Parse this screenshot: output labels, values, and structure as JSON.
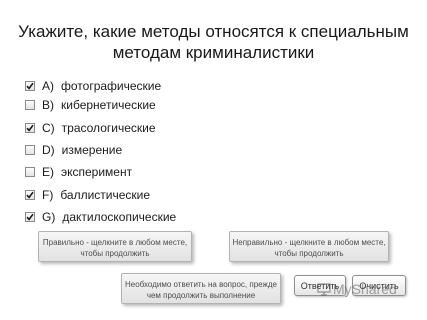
{
  "question": {
    "title_line_1": "Укажите, какие методы относятся к специальным",
    "title_line_2": "методам криминалистики"
  },
  "options": [
    {
      "letter": "A)",
      "text": "фотографические",
      "checked": true
    },
    {
      "letter": "B)",
      "text": "кибернетические",
      "checked": false
    },
    {
      "letter": "C)",
      "text": "трасологические",
      "checked": true
    },
    {
      "letter": "D)",
      "text": "измерение",
      "checked": false
    },
    {
      "letter": "E)",
      "text": "эксперимент",
      "checked": false
    },
    {
      "letter": "F)",
      "text": "баллистические",
      "checked": true
    },
    {
      "letter": "G)",
      "text": "дактилоскопические",
      "checked": true
    }
  ],
  "feedback": {
    "correct_line_1": "Правильно - щелкните в любом месте,",
    "correct_line_2": "чтобы продолжить",
    "incorrect_line_1": "Неправильно - щелкните в любом месте,",
    "incorrect_line_2": "чтобы продолжить",
    "required_line_1": "Необходимо ответить на вопрос, прежде",
    "required_line_2": "чем продолжить выполнение"
  },
  "buttons": {
    "submit_label": "Ответить",
    "clear_label": "Очистить"
  },
  "watermark": {
    "text": "MyShared",
    "icon": "presentation-icon"
  },
  "colors": {
    "checkmark": "#1a1a1a",
    "panel_border": "#b3b3b3"
  }
}
